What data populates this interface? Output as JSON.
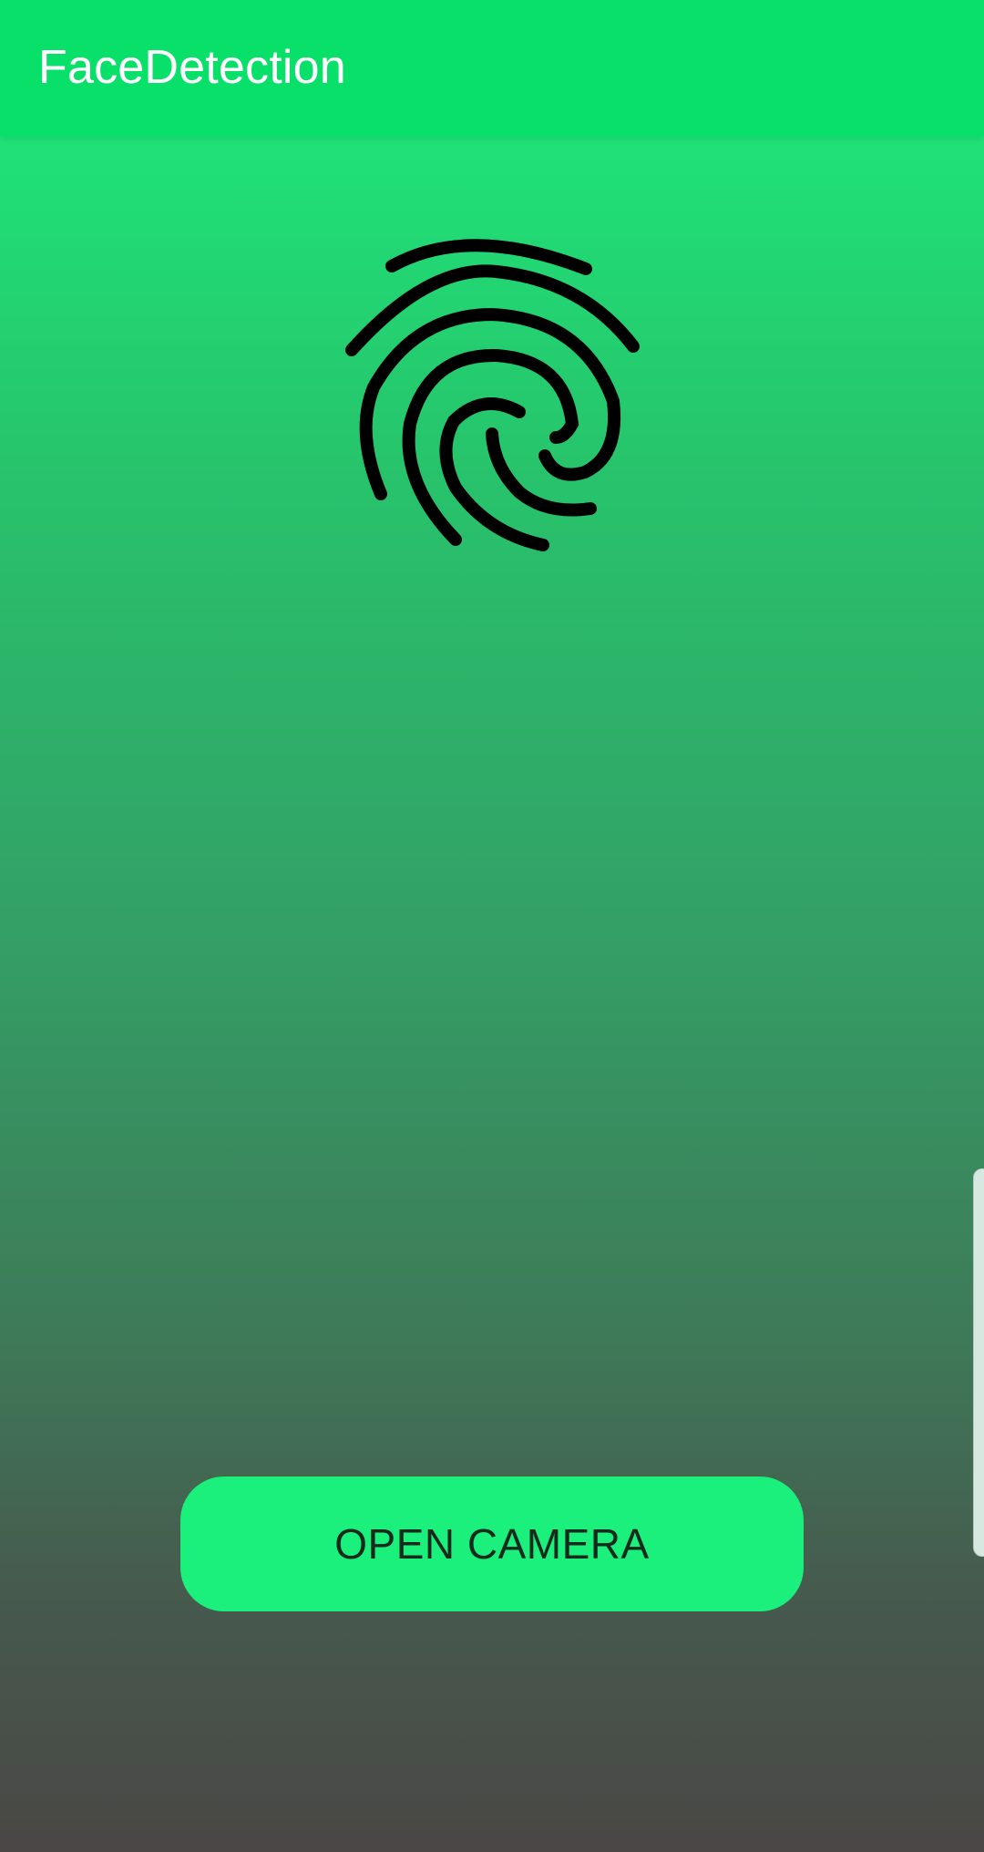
{
  "app_bar": {
    "title": "FaceDetection",
    "color": "#09e06a"
  },
  "main": {
    "icon": "fingerprint-icon",
    "button_label": "OPEN CAMERA",
    "button_color": "#1bf07c"
  },
  "edge_panel": {
    "icon": "edge-panel-handle"
  }
}
